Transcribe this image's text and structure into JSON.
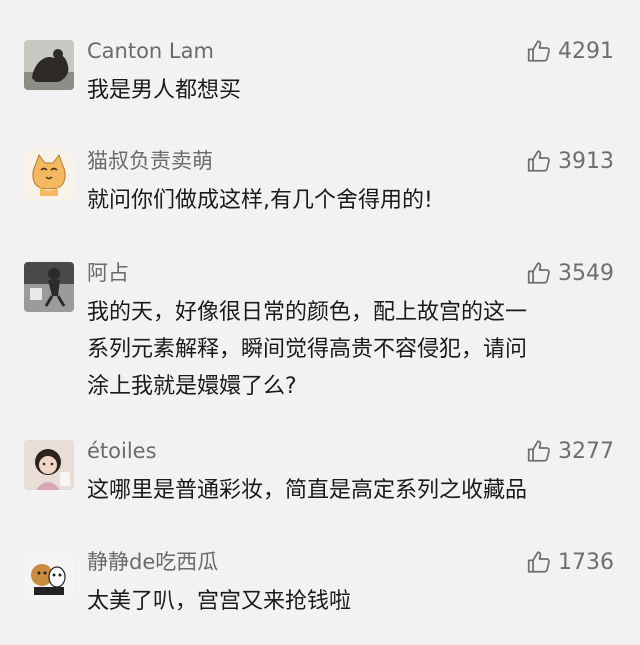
{
  "comments": [
    {
      "user": "Canton Lam",
      "likes": "4291",
      "lines": [
        "我是男人都想买"
      ]
    },
    {
      "user": "猫叔负责卖萌",
      "likes": "3913",
      "lines": [
        "就问你们做成这样,有几个舍得用的!"
      ]
    },
    {
      "user": "阿占",
      "likes": "3549",
      "lines": [
        "我的天，好像很日常的颜色，配上故宫的这一",
        "系列元素解释，瞬间觉得高贵不容侵犯，请问",
        "涂上我就是嬛嬛了么?"
      ]
    },
    {
      "user": "étoiles",
      "likes": "3277",
      "lines": [
        "这哪里是普通彩妆，简直是高定系列之收藏品"
      ]
    },
    {
      "user": "静静de吃西瓜",
      "likes": "1736",
      "lines": [
        "太美了叭，宫宫又来抢钱啦"
      ]
    }
  ],
  "icons": {
    "like": "thumbs-up-icon",
    "like_color": "#6e6e6e"
  }
}
